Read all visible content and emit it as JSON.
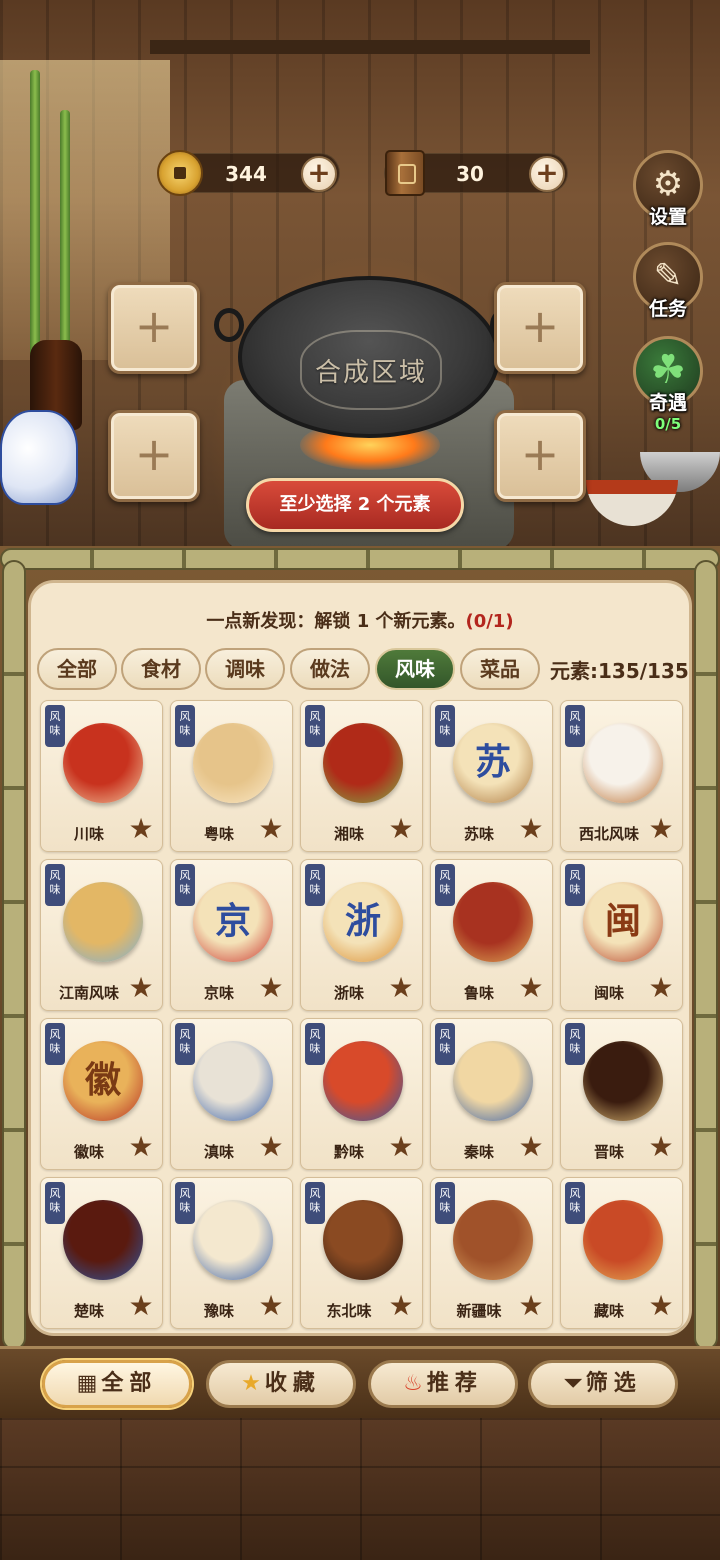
{
  "currency": {
    "coins": "344",
    "books": "30"
  },
  "side_buttons": {
    "settings_label": "设置",
    "tasks_label": "任务",
    "encounter_label": "奇遇",
    "encounter_count": "0/5"
  },
  "synthesis": {
    "wok_label": "合成区域",
    "slot_symbol": "+",
    "hint": "至少选择 2 个元素"
  },
  "panel": {
    "discovery_text": "一点新发现：解锁 1 个新元素。",
    "discovery_progress": "(0/1)",
    "tabs": [
      {
        "label": "全部"
      },
      {
        "label": "食材"
      },
      {
        "label": "调味"
      },
      {
        "label": "做法"
      },
      {
        "label": "风味",
        "active": true
      },
      {
        "label": "菜品"
      }
    ],
    "element_count": "元素:135/135",
    "tag_label": "风味",
    "cards": [
      {
        "name": "川味",
        "icon": "chili-peppers-icon"
      },
      {
        "name": "粤味",
        "icon": "dim-sum-steamer-icon"
      },
      {
        "name": "湘味",
        "icon": "flaming-chili-icon"
      },
      {
        "name": "苏味",
        "icon": "su-character-plaque-icon",
        "glyph": "苏"
      },
      {
        "name": "西北风味",
        "icon": "bun-and-skewer-icon"
      },
      {
        "name": "江南风味",
        "icon": "jiangnan-pavilion-icon"
      },
      {
        "name": "京味",
        "icon": "jing-character-scroll-icon",
        "glyph": "京"
      },
      {
        "name": "浙味",
        "icon": "zhe-character-plaque-icon",
        "glyph": "浙"
      },
      {
        "name": "鲁味",
        "icon": "braised-pork-pot-icon"
      },
      {
        "name": "闽味",
        "icon": "min-character-tag-icon",
        "glyph": "闽"
      },
      {
        "name": "徽味",
        "icon": "hui-character-tag-icon",
        "glyph": "徽"
      },
      {
        "name": "滇味",
        "icon": "crossing-bridge-noodle-icon"
      },
      {
        "name": "黔味",
        "icon": "spicy-noodle-bowl-icon"
      },
      {
        "name": "秦味",
        "icon": "biangbiang-noodle-bowl-icon"
      },
      {
        "name": "晋味",
        "icon": "vinegar-jar-icon"
      },
      {
        "name": "楚味",
        "icon": "sauce-bowl-icon"
      },
      {
        "name": "豫味",
        "icon": "noodle-soup-bowl-icon"
      },
      {
        "name": "东北味",
        "icon": "stew-pot-icon"
      },
      {
        "name": "新疆味",
        "icon": "lamb-skewer-icon"
      },
      {
        "name": "藏味",
        "icon": "butter-tea-jar-icon"
      }
    ]
  },
  "bottom_nav": [
    {
      "label": "全部",
      "icon": "grid-icon",
      "active": true
    },
    {
      "label": "收藏",
      "icon": "star-icon"
    },
    {
      "label": "推荐",
      "icon": "flame-icon"
    },
    {
      "label": "筛选",
      "icon": "filter-icon"
    }
  ],
  "colors": {
    "active_tab": "#3f6a30",
    "hint_pill": "#c0392b",
    "tag": "#3f4d7a",
    "progress_red": "#b3261e"
  }
}
